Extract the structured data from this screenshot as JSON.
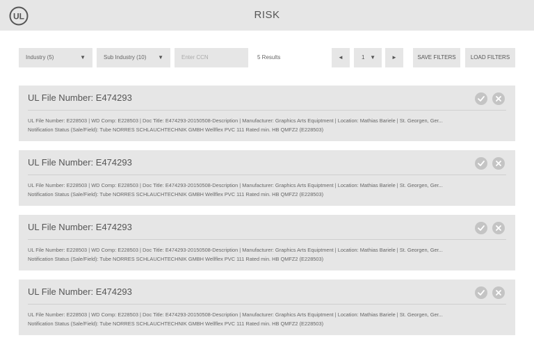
{
  "header": {
    "title": "RISK",
    "logo_text": "UL"
  },
  "filters": {
    "industry_label": "Industry (5)",
    "sub_industry_label": "Sub Industry (10)",
    "ccn_placeholder": "Enter CCN",
    "results_text": "5 Results",
    "prev_icon": "triangle-left",
    "next_icon": "triangle-right",
    "page_value": "1",
    "save_label": "SAVE FILTERS",
    "load_label": "LOAD FILTERS"
  },
  "results": [
    {
      "title": "UL File Number: E474293",
      "line1": "UL File Number: E228503 | WD Comp: E228503 | Doc Title: E474293-20150508-Description | Manufacturer: Graphics Arts Equiptment | Location: Mathias Bariele | St. Georgen, Ger...",
      "line2": "Notification Status (Sale/Field): Tube NORRES SCHLAUCHTECHNIK GMBH Wellflex PVC 111 Rated min. HB QMFZ2 (E228503)"
    },
    {
      "title": "UL File Number: E474293",
      "line1": "UL File Number: E228503 | WD Comp: E228503 | Doc Title: E474293-20150508-Description | Manufacturer: Graphics Arts Equiptment | Location: Mathias Bariele | St. Georgen, Ger...",
      "line2": "Notification Status (Sale/Field): Tube NORRES SCHLAUCHTECHNIK GMBH Wellflex PVC 111 Rated min. HB QMFZ2 (E228503)"
    },
    {
      "title": "UL File Number: E474293",
      "line1": "UL File Number: E228503 | WD Comp: E228503 | Doc Title: E474293-20150508-Description | Manufacturer: Graphics Arts Equiptment | Location: Mathias Bariele | St. Georgen, Ger...",
      "line2": "Notification Status (Sale/Field): Tube NORRES SCHLAUCHTECHNIK GMBH Wellflex PVC 111 Rated min. HB QMFZ2 (E228503)"
    },
    {
      "title": "UL File Number: E474293",
      "line1": "UL File Number: E228503 | WD Comp: E228503 | Doc Title: E474293-20150508-Description | Manufacturer: Graphics Arts Equiptment | Location: Mathias Bariele | St. Georgen, Ger...",
      "line2": "Notification Status (Sale/Field): Tube NORRES SCHLAUCHTECHNIK GMBH Wellflex PVC 111 Rated min. HB QMFZ2 (E228503)"
    }
  ],
  "colors": {
    "header_bg": "#e6e6e6",
    "card_bg": "#e6e6e6",
    "button_circle": "#c4c4c4",
    "text": "#555555"
  },
  "icons": {
    "approve": "check-icon",
    "reject": "x-icon",
    "dropdown": "triangle-down-icon"
  }
}
